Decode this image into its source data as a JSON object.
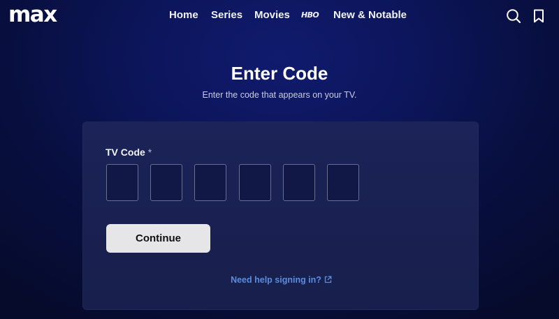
{
  "brand": {
    "logo_text": "max"
  },
  "nav": {
    "items": [
      "Home",
      "Series",
      "Movies",
      "HBO",
      "New & Notable"
    ]
  },
  "header_icons": [
    "search-icon",
    "bookmark-icon"
  ],
  "page": {
    "title": "Enter Code",
    "subtitle": "Enter the code that appears on your TV."
  },
  "form": {
    "field_label": "TV Code",
    "required_marker": "*",
    "code_slots": [
      "",
      "",
      "",
      "",
      "",
      ""
    ],
    "continue_label": "Continue",
    "help_link": "Need help signing in?"
  },
  "colors": {
    "background": "#0c1559",
    "card": "#1b2358",
    "button": "#e6e6e8",
    "link": "#5a8de0"
  }
}
